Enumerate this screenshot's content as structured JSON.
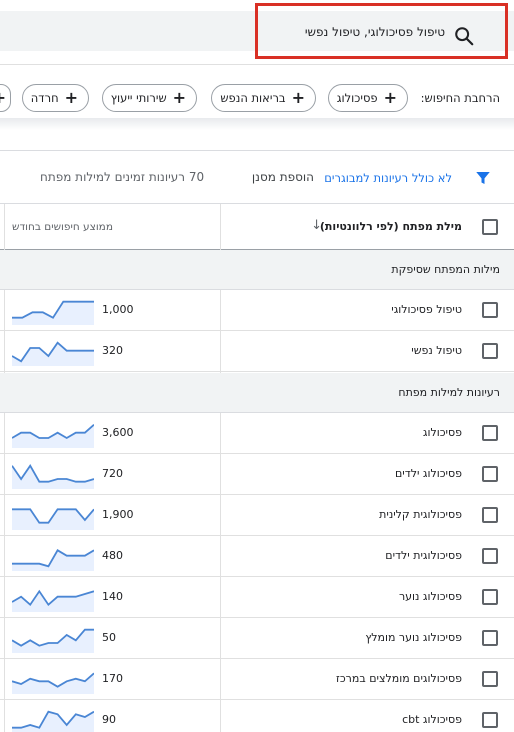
{
  "search": {
    "value": "טיפול פסיכולוגי, טיפול נפשי",
    "icon": "search-icon"
  },
  "expand": {
    "label": "הרחבת החיפוש:",
    "chips": [
      {
        "label": "פסיכולוג"
      },
      {
        "label": "בריאות הנפש"
      },
      {
        "label": "שירותי ייעוץ"
      },
      {
        "label": "חרדה"
      }
    ]
  },
  "filter": {
    "include_adult": "לא כולל רעיונות למבוגרים",
    "add_filter": "הוספת מסנן",
    "ideas_count": "70 רעיונות זמינים למילות מפתח"
  },
  "table": {
    "col_keyword": "מילת מפתח (לפי רלוונטיות)",
    "col_avg": "ממוצע חיפושים בחודש",
    "sections": [
      {
        "label": "מילות המפתח שסיפקת",
        "rows": [
          {
            "keyword": "טיפול פסיכולוגי",
            "volume": "1,000",
            "trend": [
              2,
              2,
              4,
              4,
              2,
              8,
              8,
              8,
              8
            ]
          },
          {
            "keyword": "טיפול נפשי",
            "volume": "320",
            "trend": [
              3,
              1,
              6,
              6,
              3,
              8,
              5,
              5,
              5,
              5
            ]
          }
        ]
      },
      {
        "label": "רעיונות למילות מפתח",
        "rows": [
          {
            "keyword": "פסיכולוג",
            "volume": "3,600",
            "trend": [
              3,
              5,
              5,
              3,
              3,
              5,
              3,
              5,
              5,
              8
            ]
          },
          {
            "keyword": "פסיכולוג ילדים",
            "volume": "720",
            "trend": [
              8,
              3,
              8,
              2,
              2,
              3,
              3,
              2,
              2,
              3
            ]
          },
          {
            "keyword": "פסיכולוגית קלינית",
            "volume": "1,900",
            "trend": [
              7,
              7,
              7,
              2,
              2,
              7,
              7,
              7,
              3,
              7
            ]
          },
          {
            "keyword": "פסיכולוגית ילדים",
            "volume": "480",
            "trend": [
              2,
              2,
              2,
              2,
              1,
              7,
              5,
              5,
              5,
              7
            ]
          },
          {
            "keyword": "פסיכולוג נוער",
            "volume": "140",
            "trend": [
              3,
              5,
              2,
              7,
              2,
              5,
              5,
              5,
              6,
              7
            ]
          },
          {
            "keyword": "פסיכולוג נוער מומלץ",
            "volume": "50",
            "trend": [
              4,
              2,
              4,
              2,
              3,
              3,
              6,
              4,
              8,
              8
            ]
          },
          {
            "keyword": "פסיכולוגים מומלצים במרכז",
            "volume": "170",
            "trend": [
              4,
              3,
              5,
              4,
              4,
              2,
              4,
              5,
              4,
              7
            ]
          },
          {
            "keyword": "פסיכולוג cbt",
            "volume": "90",
            "trend": [
              2,
              2,
              3,
              2,
              8,
              7,
              3,
              7,
              6,
              8
            ]
          }
        ]
      }
    ]
  },
  "colors": {
    "accent": "#1a73e8",
    "spark_line": "#4a86d4",
    "spark_fill": "#e8f0fe",
    "highlight_border": "#d93025"
  }
}
